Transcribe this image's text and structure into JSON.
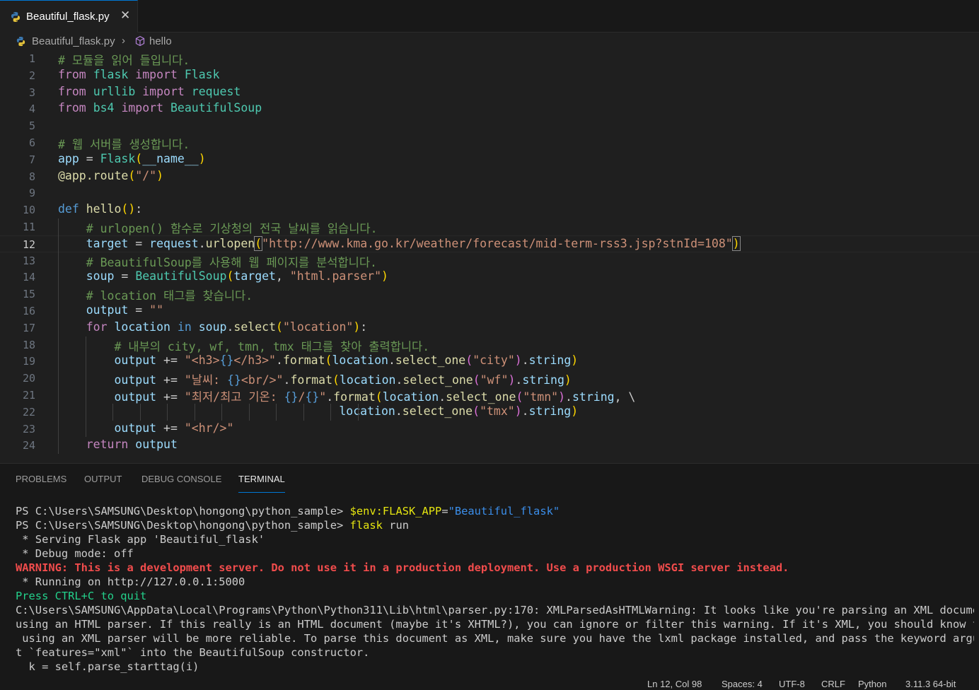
{
  "tab": {
    "filename": "Beautiful_flask.py",
    "close": "✕"
  },
  "breadcrumb": {
    "file": "Beautiful_flask.py",
    "symbol": "hello"
  },
  "lines": [
    {
      "n": "1",
      "html": "<span class='cm'># 모듈을 읽어 들입니다.</span>"
    },
    {
      "n": "2",
      "html": "<span class='kw2'>from</span> <span class='cls'>flask</span> <span class='kw2'>import</span> <span class='cls'>Flask</span>"
    },
    {
      "n": "3",
      "html": "<span class='kw2'>from</span> <span class='cls'>urllib</span> <span class='kw2'>import</span> <span class='cls'>request</span>"
    },
    {
      "n": "4",
      "html": "<span class='kw2'>from</span> <span class='cls'>bs4</span> <span class='kw2'>import</span> <span class='cls'>BeautifulSoup</span>"
    },
    {
      "n": "5",
      "html": ""
    },
    {
      "n": "6",
      "html": "<span class='cm'># 웹 서버를 생성합니다.</span>"
    },
    {
      "n": "7",
      "html": "<span class='var'>app</span> = <span class='cls'>Flask</span><span class='br1'>(</span><span class='var'>__name__</span><span class='br1'>)</span>"
    },
    {
      "n": "8",
      "html": "<span class='fn'>@app.route</span><span class='br1'>(</span><span class='str'>\"/\"</span><span class='br1'>)</span>"
    },
    {
      "n": "9",
      "html": ""
    },
    {
      "n": "10",
      "html": "<span class='kw'>def</span> <span class='fn'>hello</span><span class='br1'>()</span>:"
    },
    {
      "n": "11",
      "html": "    <span class='cm'># urlopen() 함수로 기상청의 전국 날씨를 읽습니다.</span>"
    },
    {
      "n": "12",
      "html": "    <span class='var'>target</span> = <span class='var'>request</span>.<span class='fn'>urlopen</span><span class='br1 bm'>(</span><span class='str'>\"http://www.kma.go.kr/weather/forecast/mid-term-rss3.jsp?stnId=108\"</span><span class='br1 bm'>)</span>"
    },
    {
      "n": "13",
      "html": "    <span class='cm'># BeautifulSoup를 사용해 웹 페이지를 분석합니다.</span>"
    },
    {
      "n": "14",
      "html": "    <span class='var'>soup</span> = <span class='cls'>BeautifulSoup</span><span class='br1'>(</span><span class='var'>target</span>, <span class='str'>\"html.parser\"</span><span class='br1'>)</span>"
    },
    {
      "n": "15",
      "html": "    <span class='cm'># location 태그를 찾습니다.</span>"
    },
    {
      "n": "16",
      "html": "    <span class='var'>output</span> = <span class='str'>\"\"</span>"
    },
    {
      "n": "17",
      "html": "    <span class='kw2'>for</span> <span class='var'>location</span> <span class='kw'>in</span> <span class='var'>soup</span>.<span class='fn'>select</span><span class='br1'>(</span><span class='str'>\"location\"</span><span class='br1'>)</span>:"
    },
    {
      "n": "18",
      "html": "        <span class='cm'># 내부의 city, wf, tmn, tmx 태그를 찾아 출력합니다.</span>"
    },
    {
      "n": "19",
      "html": "        <span class='var'>output</span> += <span class='str'>\"&lt;h3&gt;</span><span class='kw'>{}</span><span class='str'>&lt;/h3&gt;\"</span>.<span class='fn'>format</span><span class='br1'>(</span><span class='var'>location</span>.<span class='fn'>select_one</span><span class='br2'>(</span><span class='str'>\"city\"</span><span class='br2'>)</span>.<span class='var'>string</span><span class='br1'>)</span>"
    },
    {
      "n": "20",
      "html": "        <span class='var'>output</span> += <span class='str'>\"날씨: </span><span class='kw'>{}</span><span class='str'>&lt;br/&gt;\"</span>.<span class='fn'>format</span><span class='br1'>(</span><span class='var'>location</span>.<span class='fn'>select_one</span><span class='br2'>(</span><span class='str'>\"wf\"</span><span class='br2'>)</span>.<span class='var'>string</span><span class='br1'>)</span>"
    },
    {
      "n": "21",
      "html": "        <span class='var'>output</span> += <span class='str'>\"최저/최고 기온: </span><span class='kw'>{}</span><span class='str'>/</span><span class='kw'>{}</span><span class='str'>\"</span>.<span class='fn'>format</span><span class='br1'>(</span><span class='var'>location</span>.<span class='fn'>select_one</span><span class='br2'>(</span><span class='str'>\"tmn\"</span><span class='br2'>)</span>.<span class='var'>string</span>, \\"
    },
    {
      "n": "22",
      "html": "                                        <span class='var'>location</span>.<span class='fn'>select_one</span><span class='br2'>(</span><span class='str'>\"tmx\"</span><span class='br2'>)</span>.<span class='var'>string</span><span class='br1'>)</span>"
    },
    {
      "n": "23",
      "html": "        <span class='var'>output</span> += <span class='str'>\"&lt;hr/&gt;\"</span>"
    },
    {
      "n": "24",
      "html": "    <span class='kw2'>return</span> <span class='var'>output</span>"
    }
  ],
  "panel": {
    "tabs": [
      "PROBLEMS",
      "OUTPUT",
      "DEBUG CONSOLE",
      "TERMINAL"
    ],
    "active_tab": "TERMINAL"
  },
  "terminal": [
    "PS C:\\Users\\SAMSUNG\\Desktop\\hongong\\python_sample> <span class='cmdy'>$env:FLASK_APP</span>=<span class='cmdb'>\"Beautiful_flask\"</span>",
    "PS C:\\Users\\SAMSUNG\\Desktop\\hongong\\python_sample> <span class='cmdy'>flask</span> run",
    " * Serving Flask app 'Beautiful_flask'",
    " * Debug mode: off",
    "<span class='warn'>WARNING: This is a development server. Do not use it in a production deployment. Use a production WSGI server instead.</span>",
    " * Running on http://127.0.0.1:5000",
    "<span class='green'>Press CTRL+C to quit</span>",
    "C:\\Users\\SAMSUNG\\AppData\\Local\\Programs\\Python\\Python311\\Lib\\html\\parser.py:170: XMLParsedAsHTMLWarning: It looks like you're parsing an XML document",
    "using an HTML parser. If this really is an HTML document (maybe it's XHTML?), you can ignore or filter this warning. If it's XML, you should know that",
    " using an XML parser will be more reliable. To parse this document as XML, make sure you have the lxml package installed, and pass the keyword argumen",
    "t `features=\"xml\"` into the BeautifulSoup constructor.",
    "  k = self.parse_starttag(i)"
  ],
  "status": {
    "position": "Ln 12, Col 98",
    "spaces": "Spaces: 4",
    "encoding": "UTF-8",
    "eol": "CRLF",
    "language": "Python",
    "interpreter": "3.11.3 64-bit"
  },
  "colors": {
    "accent": "#0078d4",
    "warning": "#f14c4c",
    "prompt_ok": "#23d18b"
  }
}
